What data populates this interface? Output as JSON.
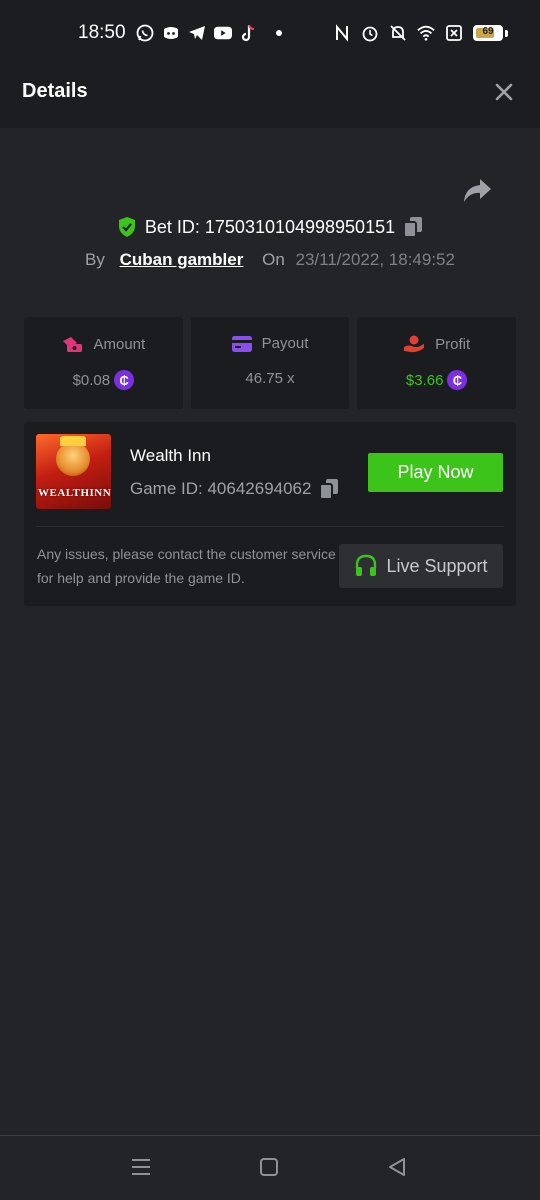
{
  "status_bar": {
    "time": "18:50",
    "app_icons": [
      "whatsapp-icon",
      "discord-icon",
      "telegram-icon",
      "youtube-icon",
      "tiktok-icon"
    ],
    "battery": "69"
  },
  "header": {
    "title": "Details"
  },
  "bet": {
    "id_label": "Bet ID: 1750310104998950151",
    "by_label": "By",
    "user": "Cuban gambler",
    "on_label": "On",
    "datetime": "23/11/2022, 18:49:52"
  },
  "stats": {
    "amount_label": "Amount",
    "amount_value": "$0.08",
    "payout_label": "Payout",
    "payout_value": "46.75 x",
    "profit_label": "Profit",
    "profit_value": "$3.66",
    "coin_symbol": "₵"
  },
  "game": {
    "name": "Wealth Inn",
    "id_label": "Game ID: 40642694062",
    "thumb_logo": "WEALTHINN",
    "play_label": "Play Now",
    "help_text": "Any issues, please contact the customer service for help and provide the game ID.",
    "support_label": "Live Support"
  },
  "colors": {
    "accent_green": "#3dc41b",
    "coin_purple": "#7b2fe0",
    "amount_icon": "#e0357a",
    "payout_icon": "#8b4cf0",
    "profit_icon": "#e0402f"
  }
}
